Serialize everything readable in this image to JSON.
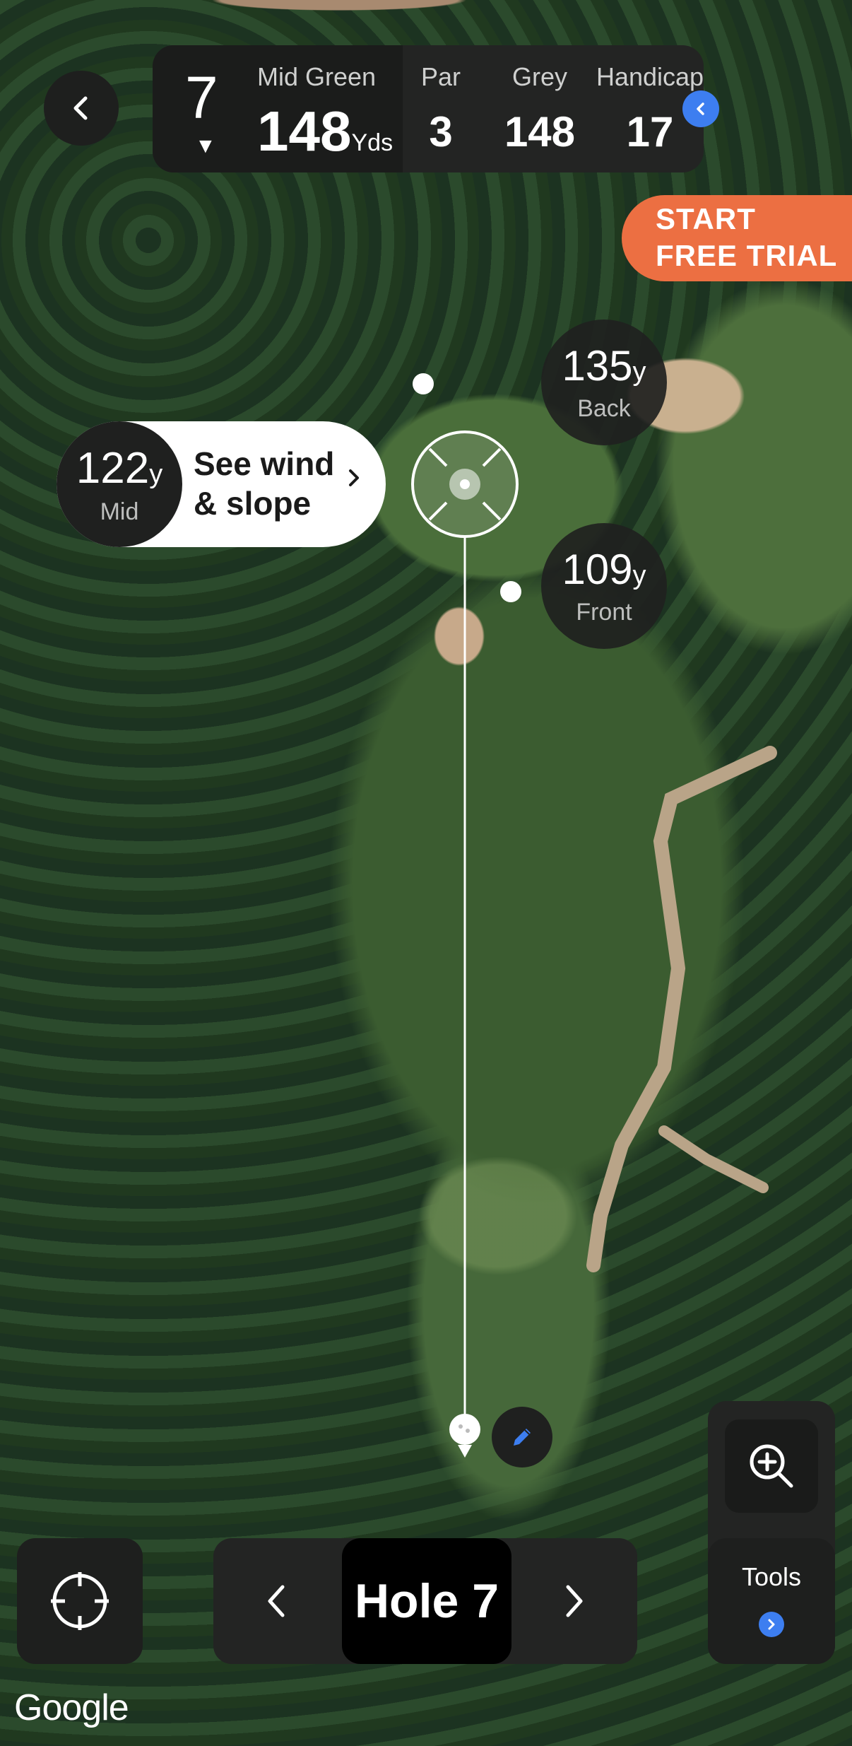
{
  "header": {
    "hole_number": "7",
    "mid_green_label": "Mid Green",
    "mid_green_value": "148",
    "mid_green_unit": "Yds",
    "par_label": "Par",
    "par_value": "3",
    "tee_label": "Grey",
    "tee_value": "148",
    "handicap_label": "Handicap",
    "handicap_value": "17"
  },
  "promo": {
    "line1": "START",
    "line2": "FREE TRIAL"
  },
  "distances": {
    "back": {
      "value": "135",
      "unit": "y",
      "label": "Back"
    },
    "mid": {
      "value": "122",
      "unit": "y",
      "label": "Mid"
    },
    "front": {
      "value": "109",
      "unit": "y",
      "label": "Front"
    }
  },
  "wind": {
    "line1": "See wind",
    "line2": "& slope"
  },
  "hole_nav": {
    "current": "Hole 7"
  },
  "tools": {
    "label": "Tools"
  },
  "map": {
    "attribution": "Google"
  },
  "colors": {
    "accent_blue": "#3d7ef0",
    "promo_orange": "#ec6f42"
  },
  "icons": [
    "back-chevron-icon",
    "caret-down-icon",
    "chevron-left-icon",
    "chevron-right-icon",
    "crosshair-icon",
    "pencil-icon",
    "zoom-in-icon",
    "golf-ball-icon",
    "target-reticle-icon"
  ]
}
